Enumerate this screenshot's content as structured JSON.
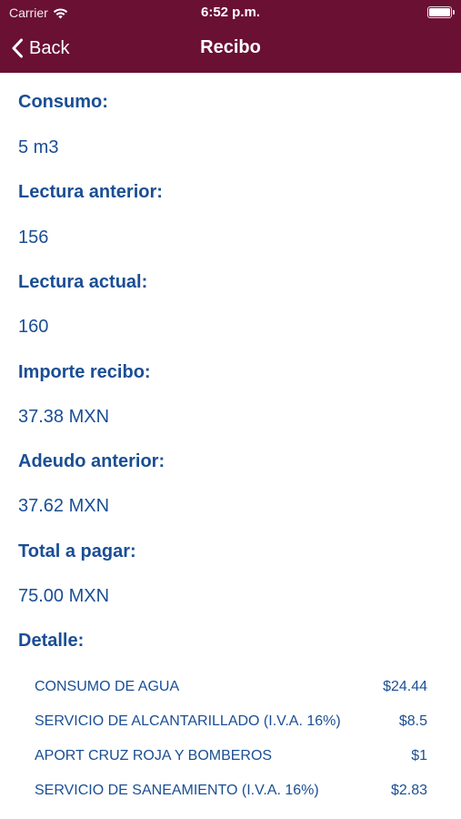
{
  "status_bar": {
    "carrier": "Carrier",
    "time": "6:52 p.m."
  },
  "nav": {
    "back_label": "Back",
    "title": "Recibo"
  },
  "fields": [
    {
      "label": "Consumo:",
      "value": "5 m3"
    },
    {
      "label": "Lectura anterior:",
      "value": "156"
    },
    {
      "label": "Lectura actual:",
      "value": "160"
    },
    {
      "label": "Importe recibo:",
      "value": "37.38 MXN"
    },
    {
      "label": "Adeudo anterior:",
      "value": "37.62 MXN"
    },
    {
      "label": "Total a pagar:",
      "value": "75.00 MXN"
    }
  ],
  "detail": {
    "label": "Detalle:",
    "items": [
      {
        "concept": "CONSUMO DE AGUA",
        "amount": "$24.44"
      },
      {
        "concept": "SERVICIO DE ALCANTARILLADO (I.V.A. 16%)",
        "amount": "$8.5"
      },
      {
        "concept": "APORT CRUZ ROJA Y BOMBEROS",
        "amount": "$1"
      },
      {
        "concept": "SERVICIO DE SANEAMIENTO (I.V.A. 16%)",
        "amount": "$2.83"
      }
    ]
  },
  "colors": {
    "header_background": "#6a1033",
    "text_blue": "#1a4e94",
    "background": "#ffffff"
  },
  "icons": [
    "wifi-icon",
    "battery-icon",
    "chevron-left-icon"
  ]
}
